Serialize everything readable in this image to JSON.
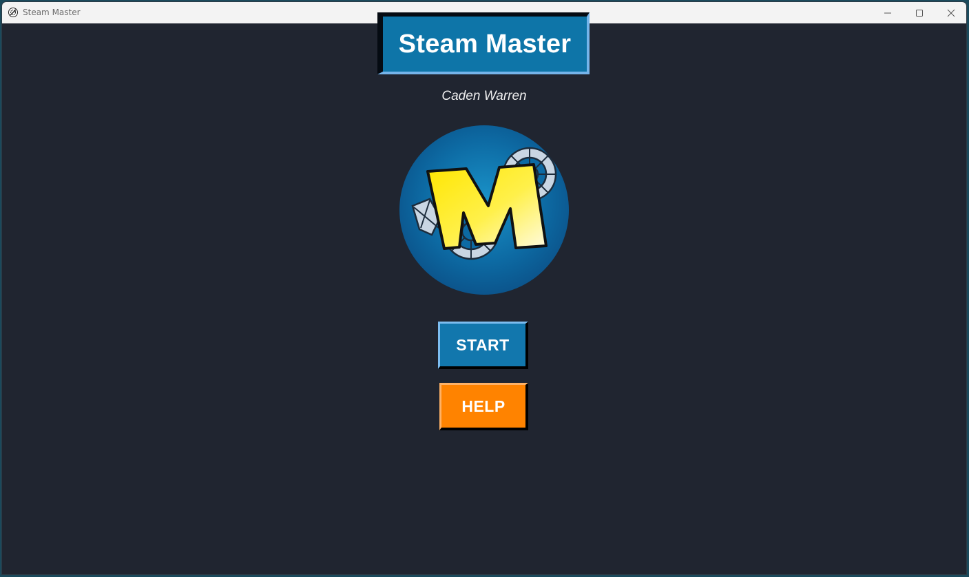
{
  "window": {
    "title": "Steam Master",
    "icon": "steam-master-app-icon",
    "controls": {
      "minimize": "minimize-icon",
      "maximize": "maximize-icon",
      "close": "close-icon"
    }
  },
  "main": {
    "title": "Steam Master",
    "author": "Caden Warren",
    "logo": {
      "letter": "M",
      "icon": "steam-gears-logo"
    },
    "buttons": {
      "start_label": "START",
      "help_label": "HELP"
    }
  },
  "colors": {
    "background": "#202530",
    "title_bg": "#0e75a8",
    "start_bg": "#1277ad",
    "help_bg": "#ff8300",
    "logo_letter": "#ffe600"
  }
}
